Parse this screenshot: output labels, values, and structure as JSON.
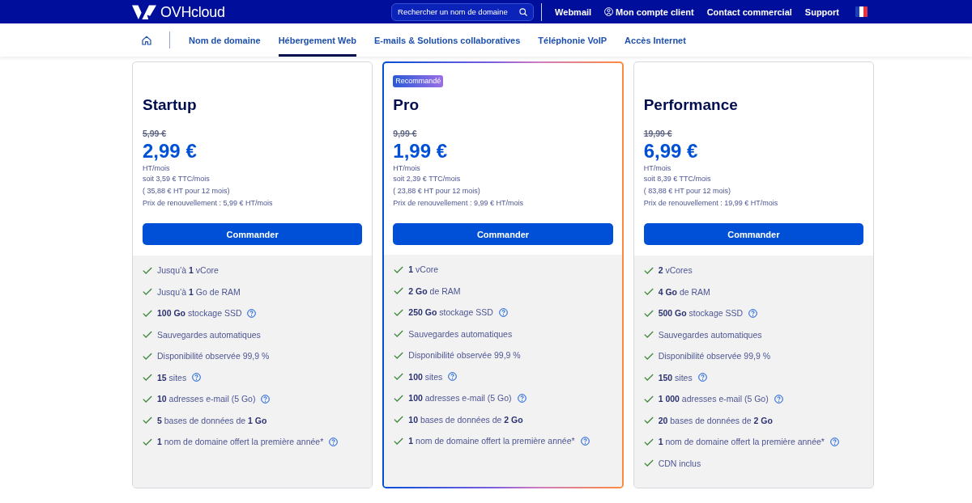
{
  "header": {
    "logo": "OVHcloud",
    "search": {
      "placeholder": "Rechercher un nom de domaine"
    },
    "links": [
      {
        "kind": "link",
        "label": "Webmail"
      },
      {
        "kind": "account",
        "label": "Mon compte client"
      },
      {
        "kind": "link",
        "label": "Contact commercial"
      },
      {
        "kind": "link",
        "label": "Support"
      }
    ]
  },
  "nav": {
    "items": [
      {
        "label": "Nom de domaine",
        "selected": false
      },
      {
        "label": "Hébergement Web",
        "selected": true
      },
      {
        "label": "E-mails & Solutions collaboratives",
        "selected": false
      },
      {
        "label": "Téléphonie VoIP",
        "selected": false
      },
      {
        "label": "Accès Internet",
        "selected": false
      }
    ]
  },
  "plans": [
    {
      "name": "Startup",
      "recommended": false,
      "old_price": "5,99 €",
      "price": "2,99 €",
      "price_unit": "HT/mois",
      "price_notes": [
        "soit 3,59 € TTC/mois",
        "( 35,88 € HT pour 12 mois)",
        "Prix de renouvellement : 5,99 € HT/mois"
      ],
      "button": "Commander",
      "features": [
        {
          "text": "Jusqu’à **1** vCore",
          "help": false
        },
        {
          "text": "Jusqu’à **1** Go de RAM",
          "help": false
        },
        {
          "text": "**100 Go** stockage SSD",
          "help": true
        },
        {
          "text": "Sauvegardes automatiques",
          "help": false
        },
        {
          "text": "Disponibilité observée 99,9 %",
          "help": false
        },
        {
          "text": "**15** sites",
          "help": true
        },
        {
          "text": "**10** adresses e-mail (5 Go)",
          "help": true
        },
        {
          "text": "**5** bases de données de **1 Go**",
          "help": false
        },
        {
          "text": "**1** nom de domaine offert la première année*",
          "help": true
        }
      ]
    },
    {
      "name": "Pro",
      "recommended": true,
      "badge": "Recommandé",
      "old_price": "9,99 €",
      "price": "1,99 €",
      "price_unit": "HT/mois",
      "price_notes": [
        "soit 2,39 € TTC/mois",
        "( 23,88 € HT pour 12 mois)",
        "Prix de renouvellement : 9,99 € HT/mois"
      ],
      "button": "Commander",
      "features": [
        {
          "text": "**1** vCore",
          "help": false
        },
        {
          "text": "**2 Go** de RAM",
          "help": false
        },
        {
          "text": "**250 Go** stockage SSD",
          "help": true
        },
        {
          "text": "Sauvegardes automatiques",
          "help": false
        },
        {
          "text": "Disponibilité observée 99,9 %",
          "help": false
        },
        {
          "text": "**100** sites",
          "help": true
        },
        {
          "text": "**100** adresses e-mail (5 Go)",
          "help": true
        },
        {
          "text": "**10** bases de données de **2 Go**",
          "help": false
        },
        {
          "text": "**1** nom de domaine offert la première année*",
          "help": true
        }
      ]
    },
    {
      "name": "Performance",
      "recommended": false,
      "old_price": "19,99 €",
      "price": "6,99 €",
      "price_unit": "HT/mois",
      "price_notes": [
        "soit 8,39 € TTC/mois",
        "( 83,88 € HT pour 12 mois)",
        "Prix de renouvellement : 19,99 € HT/mois"
      ],
      "button": "Commander",
      "features": [
        {
          "text": "**2** vCores",
          "help": false
        },
        {
          "text": "**4 Go** de RAM",
          "help": false
        },
        {
          "text": "**500 Go** stockage SSD",
          "help": true
        },
        {
          "text": "Sauvegardes automatiques",
          "help": false
        },
        {
          "text": "Disponibilité observée 99,9 %",
          "help": false
        },
        {
          "text": "**150** sites",
          "help": true
        },
        {
          "text": "**1 000** adresses e-mail (5 Go)",
          "help": true
        },
        {
          "text": "**20** bases de données de **2 Go**",
          "help": false
        },
        {
          "text": "**1** nom de domaine offert la première année*",
          "help": true
        },
        {
          "text": "CDN inclus",
          "help": false
        }
      ]
    }
  ]
}
